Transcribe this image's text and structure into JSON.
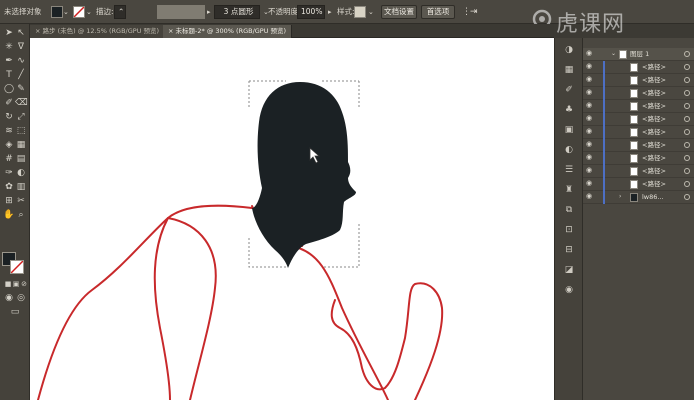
{
  "control_bar": {
    "selection_status": "未选择对象",
    "stroke_label": "描边:",
    "brush_dropdown": "3 点圆形",
    "opacity_label": "不透明度:",
    "opacity_value": "100%",
    "style_label": "样式:",
    "doc_setup_button": "文档设置",
    "preferences_button": "首选项"
  },
  "tabs": [
    {
      "label": "路步 (未色) @ 12.5% (RGB/GPU 预览)"
    },
    {
      "label": "未标题-2* @ 300% (RGB/GPU 预览)"
    }
  ],
  "watermark": {
    "text": "虎课网"
  },
  "layers": {
    "group_name": "图层 1",
    "rows": [
      {
        "name": "<路径>"
      },
      {
        "name": "<路径>"
      },
      {
        "name": "<路径>"
      },
      {
        "name": "<路径>"
      },
      {
        "name": "<路径>"
      },
      {
        "name": "<路径>"
      },
      {
        "name": "<路径>"
      },
      {
        "name": "<路径>"
      },
      {
        "name": "<路径>"
      },
      {
        "name": "<路径>"
      }
    ],
    "last_row": "lw86..."
  },
  "colors": {
    "ui_bg": "#4a4740",
    "canvas_bg": "#ffffff",
    "head_fill": "#1b2124",
    "path_stroke": "#c8292b",
    "layer_accent": "#4d6fc4"
  }
}
